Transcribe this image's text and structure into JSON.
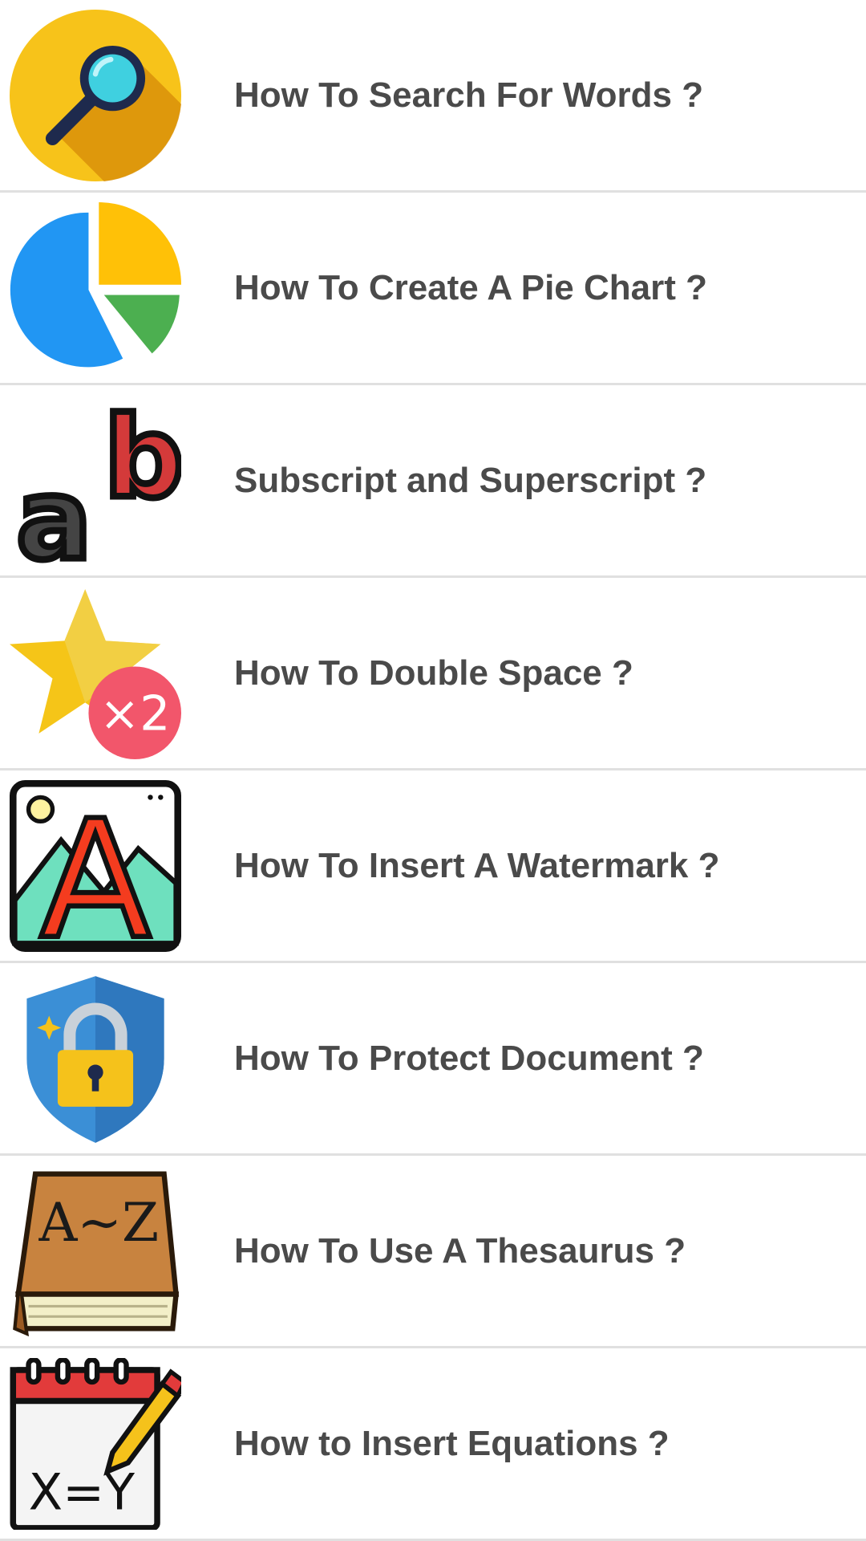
{
  "items": [
    {
      "label": "How To Search For Words ?",
      "icon": "magnifier-icon"
    },
    {
      "label": "How To Create A Pie Chart ?",
      "icon": "pie-chart-icon"
    },
    {
      "label": "Subscript and Superscript ?",
      "icon": "superscript-icon"
    },
    {
      "label": "How To Double Space ?",
      "icon": "star-x2-icon"
    },
    {
      "label": "How To Insert A Watermark ?",
      "icon": "watermark-icon"
    },
    {
      "label": "How To Protect Document ?",
      "icon": "shield-lock-icon"
    },
    {
      "label": "How To Use A Thesaurus ?",
      "icon": "book-icon"
    },
    {
      "label": "How to Insert Equations ?",
      "icon": "equation-notepad-icon"
    }
  ],
  "icon_text": {
    "superscript_a": "a",
    "superscript_b": "b",
    "double": "×2",
    "watermark_letter": "A",
    "book_az": "A~Z",
    "equation": "X=Y"
  },
  "colors": {
    "text": "#4a4a4a",
    "divider": "#e0e0e0"
  }
}
